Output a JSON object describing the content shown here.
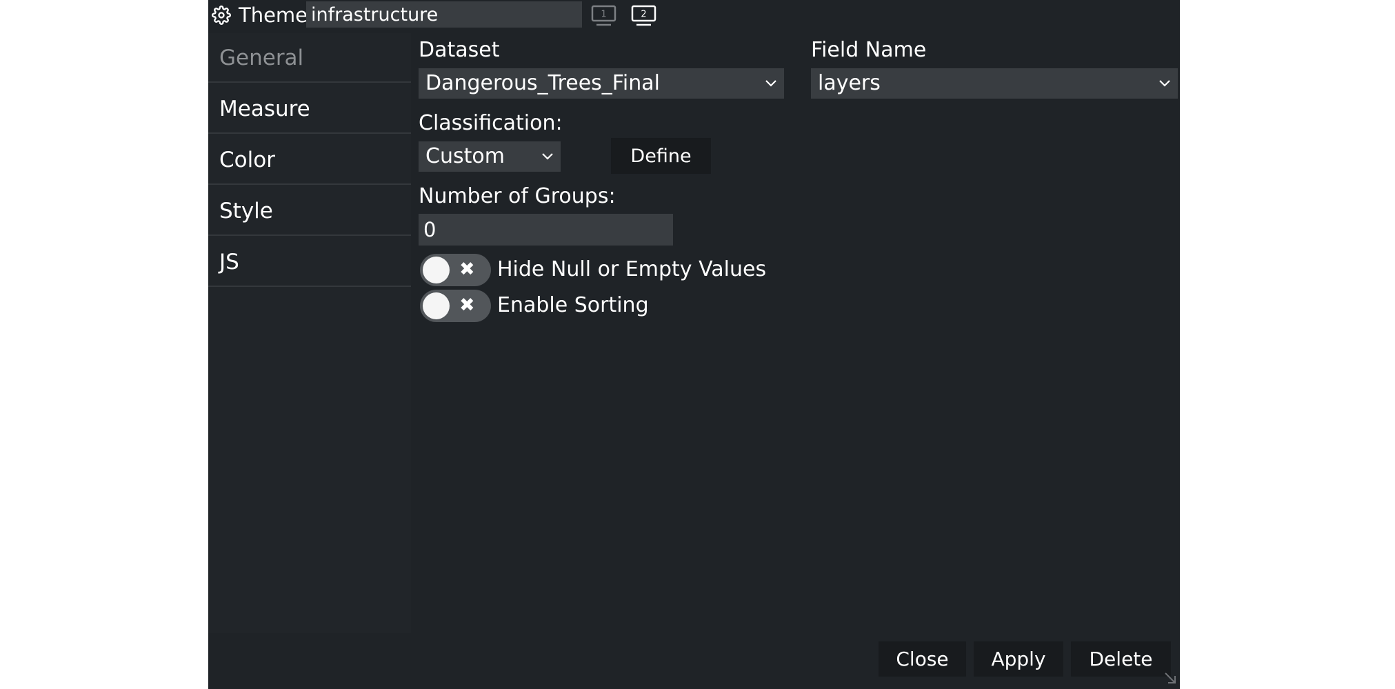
{
  "title_bar": {
    "label": "Theme",
    "theme_name": "infrastructure",
    "screen_buttons": [
      "1",
      "2"
    ]
  },
  "sidebar": {
    "items": [
      {
        "label": "General",
        "active": true
      },
      {
        "label": "Measure"
      },
      {
        "label": "Color"
      },
      {
        "label": "Style"
      },
      {
        "label": "JS"
      }
    ]
  },
  "main": {
    "dataset_label": "Dataset",
    "dataset_value": "Dangerous_Trees_Final",
    "field_name_label": "Field Name",
    "field_name_value": "layers",
    "classification_label": "Classification:",
    "classification_value": "Custom",
    "define_label": "Define",
    "groups_label": "Number of Groups:",
    "groups_value": "0",
    "hide_null_label": "Hide Null or Empty Values",
    "enable_sorting_label": "Enable Sorting"
  },
  "footer": {
    "close_label": "Close",
    "apply_label": "Apply",
    "delete_label": "Delete"
  },
  "colors": {
    "dialog_bg": "#1f2327",
    "input_bg": "#393d41",
    "button_bg": "#181b1e",
    "inactive_text": "#8e9194"
  }
}
